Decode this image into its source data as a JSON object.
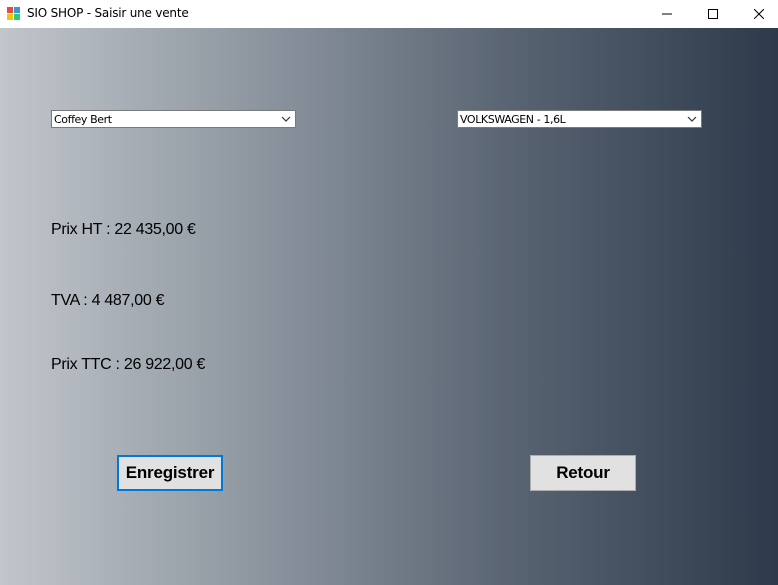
{
  "window": {
    "title": "SIO SHOP - Saisir une vente",
    "icon": "winforms-app-icon",
    "controls": [
      "minimize-icon",
      "maximize-icon",
      "close-icon"
    ]
  },
  "form": {
    "client_select": {
      "selected": "Coffey Bert"
    },
    "vehicle_select": {
      "selected": "VOLKSWAGEN - 1,6L"
    },
    "prix_ht": "Prix HT : 22 435,00 €",
    "tva": "TVA : 4 487,00 €",
    "prix_ttc": "Prix TTC : 26 922,00 €",
    "save_label": "Enregistrer",
    "back_label": "Retour"
  },
  "colors": {
    "gradient_start": "#c1c6cb",
    "gradient_end": "#2c3a4b",
    "button_bg": "#e1e1e1",
    "focus_border": "#0078d7"
  }
}
